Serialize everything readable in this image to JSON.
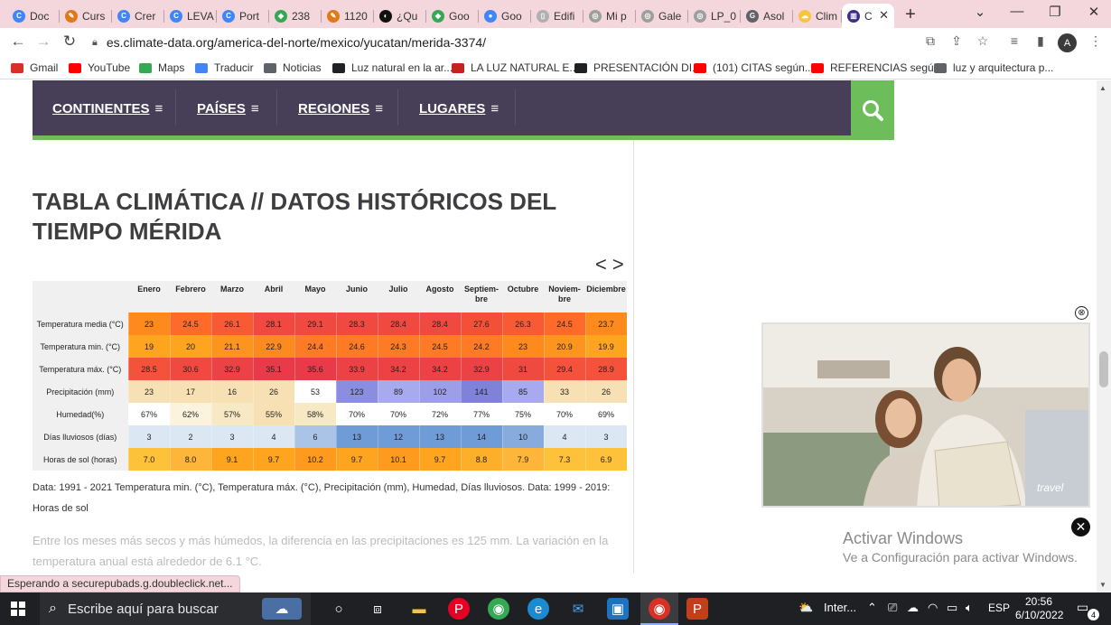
{
  "browser": {
    "tabs": [
      {
        "label": "Doc",
        "color": "#4285f4",
        "glyph": "C"
      },
      {
        "label": "Curs",
        "color": "#e07a18",
        "glyph": "✎"
      },
      {
        "label": "Crer",
        "color": "#4285f4",
        "glyph": "C"
      },
      {
        "label": "LEVA",
        "color": "#4285f4",
        "glyph": "C"
      },
      {
        "label": "Port",
        "color": "#4285f4",
        "glyph": "C"
      },
      {
        "label": "238",
        "color": "#34a853",
        "glyph": "◆"
      },
      {
        "label": "1120",
        "color": "#e07a18",
        "glyph": "✎"
      },
      {
        "label": "¿Qu",
        "color": "#111111",
        "glyph": "◐"
      },
      {
        "label": "Goo",
        "color": "#34a853",
        "glyph": "◆"
      },
      {
        "label": "Goo",
        "color": "#4285f4",
        "glyph": "●"
      },
      {
        "label": "Edifi",
        "color": "#b0b0b0",
        "glyph": "▯"
      },
      {
        "label": "Mi p",
        "color": "#9e9e9e",
        "glyph": "◎"
      },
      {
        "label": "Gale",
        "color": "#9e9e9e",
        "glyph": "◎"
      },
      {
        "label": "LP_0",
        "color": "#9e9e9e",
        "glyph": "◎"
      },
      {
        "label": "Asol",
        "color": "#5f6368",
        "glyph": "G"
      },
      {
        "label": "Clim",
        "color": "#f5c542",
        "glyph": "☁"
      },
      {
        "label": "C",
        "color": "#3b2e8a",
        "glyph": "▥"
      }
    ],
    "url": "es.climate-data.org/america-del-norte/mexico/yucatan/merida-3374/",
    "avatar_letter": "A",
    "status_text": "Esperando a securepubads.g.doubleclick.net..."
  },
  "bookmarks": [
    {
      "label": "Gmail",
      "color": "#d93025"
    },
    {
      "label": "YouTube",
      "color": "#ff0000"
    },
    {
      "label": "Maps",
      "color": "#34a853"
    },
    {
      "label": "Traducir",
      "color": "#4285f4"
    },
    {
      "label": "Noticias",
      "color": "#5f6368"
    },
    {
      "label": "Luz natural en la ar...",
      "color": "#202124"
    },
    {
      "label": "LA LUZ NATURAL E...",
      "color": "#c5221f"
    },
    {
      "label": "PRESENTACIÓN DI...",
      "color": "#202124"
    },
    {
      "label": "(101) CITAS según...",
      "color": "#ff0000"
    },
    {
      "label": "REFERENCIAS segú...",
      "color": "#ff0000"
    },
    {
      "label": "luz y arquitectura p...",
      "color": "#5f6368"
    }
  ],
  "site_nav": {
    "items": [
      "CONTINENTES",
      "PAÍSES",
      "REGIONES",
      "LUGARES"
    ]
  },
  "page": {
    "title": "TABLA CLIMÁTICA // DATOS HISTÓRICOS DEL TIEMPO MÉRIDA",
    "prev_arrow": "<",
    "next_arrow": ">",
    "note": "Data: 1991 - 2021 Temperatura min. (°C), Temperatura máx. (°C), Precipitación (mm), Humedad, Días lluviosos. Data: 1999 - 2019: Horas de sol",
    "fade_text": "Entre los meses más secos y más húmedos, la diferencia en las precipitaciones es 125 mm. La variación en la temperatura anual está alrededor de 6.1 °C."
  },
  "chart_data": {
    "type": "table",
    "columns": [
      "Enero",
      "Febrero",
      "Marzo",
      "Abril",
      "Mayo",
      "Junio",
      "Julio",
      "Agosto",
      "Septiem-bre",
      "Octubre",
      "Noviem-bre",
      "Diciembre"
    ],
    "rows": [
      {
        "label": "Temperatura media (°C)",
        "values": [
          "23",
          "24.5",
          "26.1",
          "28.1",
          "29.1",
          "28.3",
          "28.4",
          "28.4",
          "27.6",
          "26.3",
          "24.5",
          "23.7"
        ],
        "colors": [
          "#fe8a1e",
          "#fd6a2a",
          "#f85a36",
          "#f04a40",
          "#f04a40",
          "#f04a40",
          "#f04a40",
          "#f04a40",
          "#f45038",
          "#f85a36",
          "#fd6a2a",
          "#fe8a1e"
        ]
      },
      {
        "label": "Temperatura min. (°C)",
        "values": [
          "19",
          "20",
          "21.1",
          "22.9",
          "24.4",
          "24.6",
          "24.3",
          "24.5",
          "24.2",
          "23",
          "20.9",
          "19.9"
        ],
        "colors": [
          "#fea41e",
          "#fea41e",
          "#fd941e",
          "#fd8a1e",
          "#fe7a24",
          "#fe7a24",
          "#fe7a24",
          "#fe7a24",
          "#fe7a24",
          "#fe8a1e",
          "#fd941e",
          "#fea41e"
        ]
      },
      {
        "label": "Temperatura máx. (°C)",
        "values": [
          "28.5",
          "30.6",
          "32.9",
          "35.1",
          "35.6",
          "33.9",
          "34.2",
          "34.2",
          "32.9",
          "31",
          "29.4",
          "28.9"
        ],
        "colors": [
          "#f5523c",
          "#f04a40",
          "#ec4246",
          "#e83a48",
          "#e83a48",
          "#ec4246",
          "#ec4246",
          "#ec4246",
          "#ec4246",
          "#f04a40",
          "#f5523c",
          "#f5523c"
        ]
      },
      {
        "label": "Precipitación (mm)",
        "values": [
          "23",
          "17",
          "16",
          "26",
          "53",
          "123",
          "89",
          "102",
          "141",
          "85",
          "33",
          "26"
        ],
        "colors": [
          "#f7e1b4",
          "#f7e1b4",
          "#f7e1b4",
          "#f7e1b4",
          "#ffffff",
          "#8a8de0",
          "#a8aaf0",
          "#9c9ee8",
          "#7f82d8",
          "#a8aaf0",
          "#f7e1b4",
          "#f7e1b4"
        ]
      },
      {
        "label": "Humedad(%)",
        "values": [
          "67%",
          "62%",
          "57%",
          "55%",
          "58%",
          "70%",
          "70%",
          "72%",
          "77%",
          "75%",
          "70%",
          "69%"
        ],
        "colors": [
          "#ffffff",
          "#fbf3de",
          "#f7e9c4",
          "#f7e1b4",
          "#f7e9c4",
          "#ffffff",
          "#ffffff",
          "#ffffff",
          "#ffffff",
          "#ffffff",
          "#ffffff",
          "#ffffff"
        ]
      },
      {
        "label": "Días lluviosos (días)",
        "values": [
          "3",
          "2",
          "3",
          "4",
          "6",
          "13",
          "12",
          "13",
          "14",
          "10",
          "4",
          "3"
        ],
        "colors": [
          "#dce7f4",
          "#dce7f4",
          "#dce7f4",
          "#dce7f4",
          "#a9c4e6",
          "#6f9bd6",
          "#6f9bd6",
          "#6f9bd6",
          "#6f9bd6",
          "#86abdc",
          "#dce7f4",
          "#dce7f4"
        ]
      },
      {
        "label": "Horas de sol (horas)",
        "values": [
          "7.0",
          "8.0",
          "9.1",
          "9.7",
          "10.2",
          "9.7",
          "10.1",
          "9.7",
          "8.8",
          "7.9",
          "7.3",
          "6.9"
        ],
        "colors": [
          "#fdc13a",
          "#fdb53a",
          "#fea41e",
          "#fea41e",
          "#fe9a1e",
          "#fea41e",
          "#fe9a1e",
          "#fea41e",
          "#fdaf2a",
          "#fdb53a",
          "#fdc13a",
          "#fdc13a"
        ]
      }
    ]
  },
  "ad": {
    "brand": "travel",
    "close_glyph": "⊗",
    "dismiss_glyph": "✕"
  },
  "watermark": {
    "line1": "Activar Windows",
    "line2": "Ve a Configuración para activar Windows."
  },
  "taskbar": {
    "search_placeholder": "Escribe aquí para buscar",
    "weather": "Inter...",
    "language": "ESP",
    "time": "20:56",
    "date": "6/10/2022",
    "notifications": "4"
  }
}
